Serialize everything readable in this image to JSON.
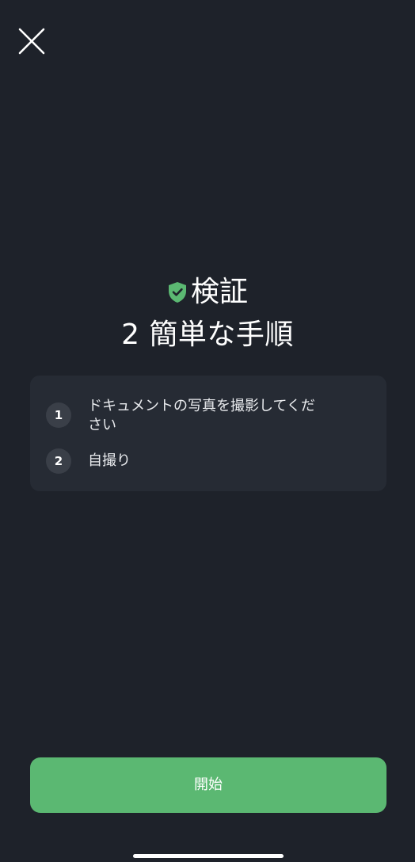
{
  "colors": {
    "background": "#1e222a",
    "card": "#262b34",
    "badge": "#3a3f48",
    "accent_green": "#5bb872",
    "text": "#ffffff"
  },
  "toolbar": {
    "close_icon": "close-icon"
  },
  "header": {
    "shield_icon": "shield-check-icon",
    "title": "検証",
    "subtitle": "2 簡単な手順"
  },
  "steps": [
    {
      "number": "1",
      "label": "ドキュメントの写真を撮影してください"
    },
    {
      "number": "2",
      "label": "自撮り"
    }
  ],
  "actions": {
    "start_label": "開始"
  }
}
